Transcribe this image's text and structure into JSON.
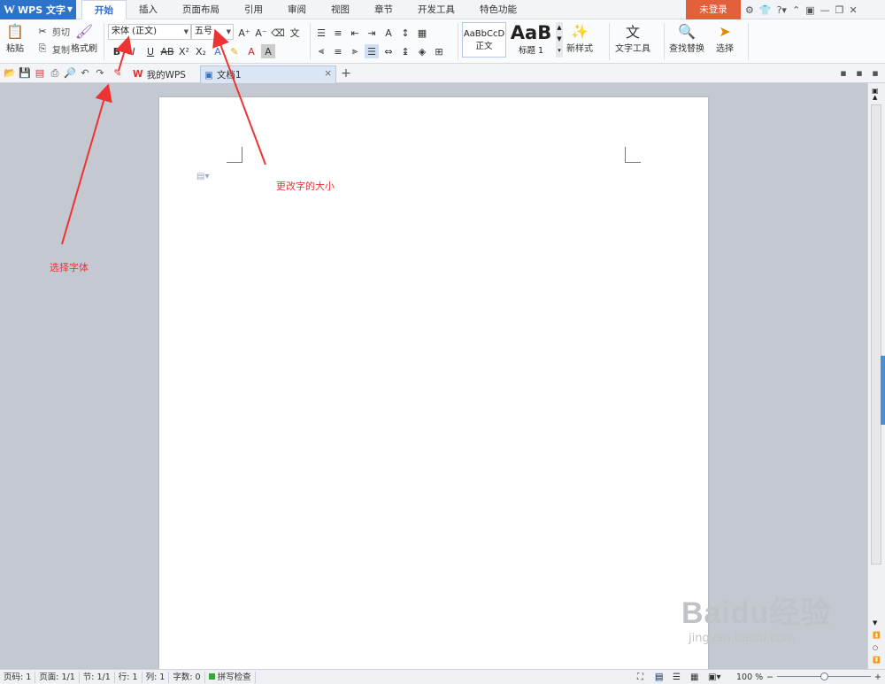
{
  "app": {
    "title": "WPS 文字"
  },
  "menu_tabs": [
    "开始",
    "插入",
    "页面布局",
    "引用",
    "审阅",
    "视图",
    "章节",
    "开发工具",
    "特色功能"
  ],
  "login": "未登录",
  "ribbon": {
    "paste": "粘贴",
    "cut": "剪切",
    "copy": "复制",
    "format_painter": "格式刷",
    "font_name": "宋体 (正文)",
    "font_size": "五号",
    "style_normal_preview": "AaBbCcD",
    "style_normal": "正文",
    "style_heading_preview": "AaB",
    "style_heading": "标题 1",
    "new_style": "新样式",
    "text_tools": "文字工具",
    "find_replace": "查找替换",
    "select": "选择"
  },
  "doc_tabs": {
    "mywps": "我的WPS",
    "doc1": "文档1"
  },
  "annotations": {
    "font": "选择字体",
    "size": "更改字的大小"
  },
  "status": {
    "page_no": "页码: 1",
    "pages": "页面: 1/1",
    "section": "节: 1/1",
    "row": "行: 1",
    "col": "列: 1",
    "words": "字数: 0",
    "spell": "拼写检查",
    "zoom": "100 %"
  },
  "watermark": {
    "brand": "Baidu经验",
    "url": "jingyan.baidu.com"
  },
  "colors": {
    "accent": "#2d73c9",
    "login": "#e3603c",
    "annotation": "#e33333"
  }
}
